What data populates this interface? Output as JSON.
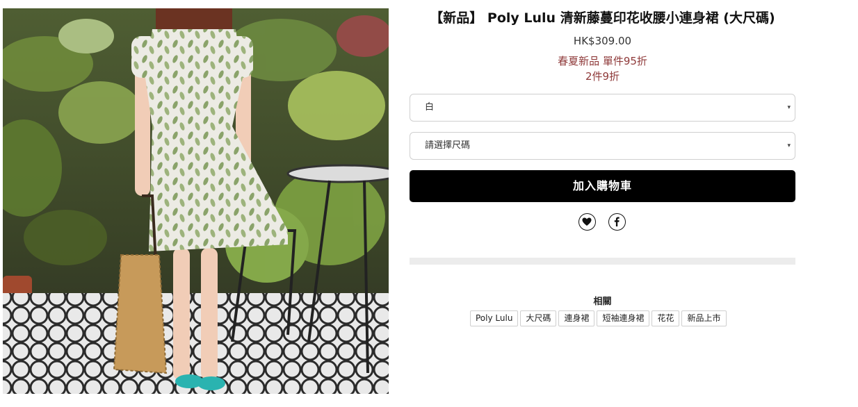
{
  "product": {
    "title": "【新品】 Poly Lulu 清新藤蔓印花收腰小連身裙 (大尺碼)",
    "price": "HK$309.00",
    "promo_line1": "春夏新品 單件95折",
    "promo_line2": "2件9折"
  },
  "options": {
    "color_selected": "白",
    "size_placeholder": "請選擇尺碼"
  },
  "actions": {
    "add_to_cart": "加入購物車",
    "caret": "▾"
  },
  "icons": {
    "wishlist": "heart-icon",
    "share": "facebook-icon"
  },
  "related": {
    "title": "相關",
    "tags": [
      "Poly Lulu",
      "大尺碼",
      "連身裙",
      "短袖連身裙",
      "花花",
      "新品上市"
    ]
  },
  "colors": {
    "promo": "#8f3a3a",
    "button_bg": "#000000",
    "button_text": "#ffffff"
  }
}
